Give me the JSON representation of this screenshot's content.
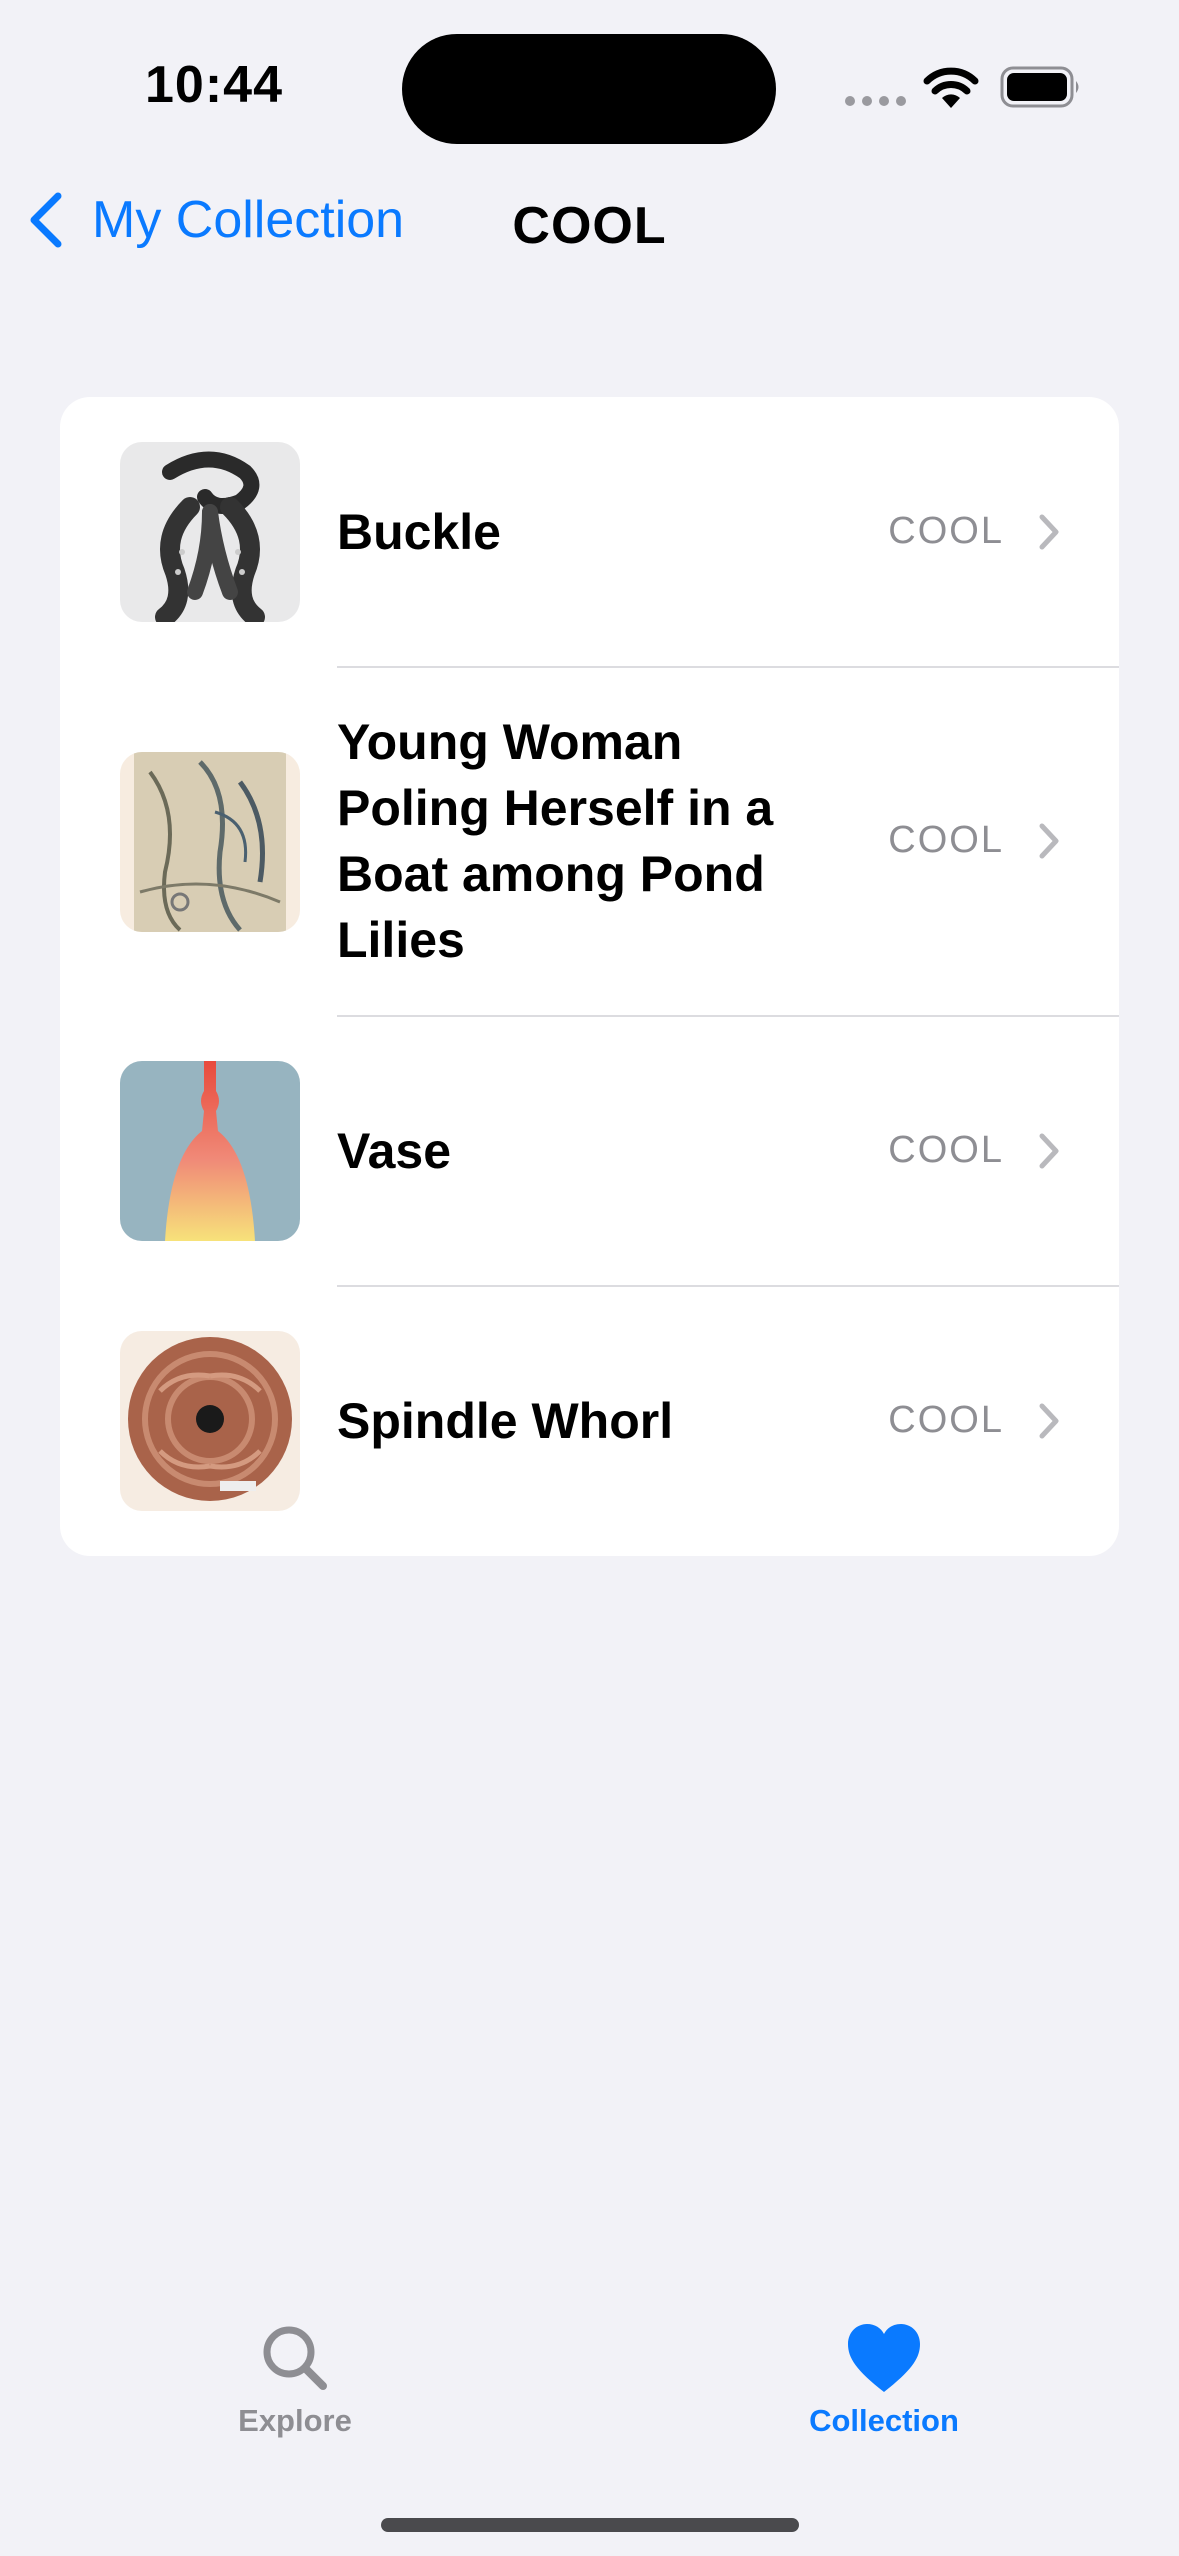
{
  "status_bar": {
    "time": "10:44"
  },
  "nav": {
    "back_label": "My Collection",
    "title": "COOL"
  },
  "items": [
    {
      "name": "Buckle",
      "tag": "COOL",
      "thumbnail": "buckle-thumbnail"
    },
    {
      "name": "Young Woman Poling Herself in a Boat among Pond Lilies",
      "tag": "COOL",
      "thumbnail": "painting-thumbnail"
    },
    {
      "name": "Vase",
      "tag": "COOL",
      "thumbnail": "vase-thumbnail"
    },
    {
      "name": "Spindle Whorl",
      "tag": "COOL",
      "thumbnail": "spindle-whorl-thumbnail"
    }
  ],
  "tab_bar": {
    "explore": {
      "label": "Explore",
      "icon": "search-icon"
    },
    "collection": {
      "label": "Collection",
      "icon": "heart-icon"
    }
  },
  "colors": {
    "accent": "#0a7aff",
    "background": "#f2f2f7",
    "secondary_text": "#8e8e93"
  }
}
